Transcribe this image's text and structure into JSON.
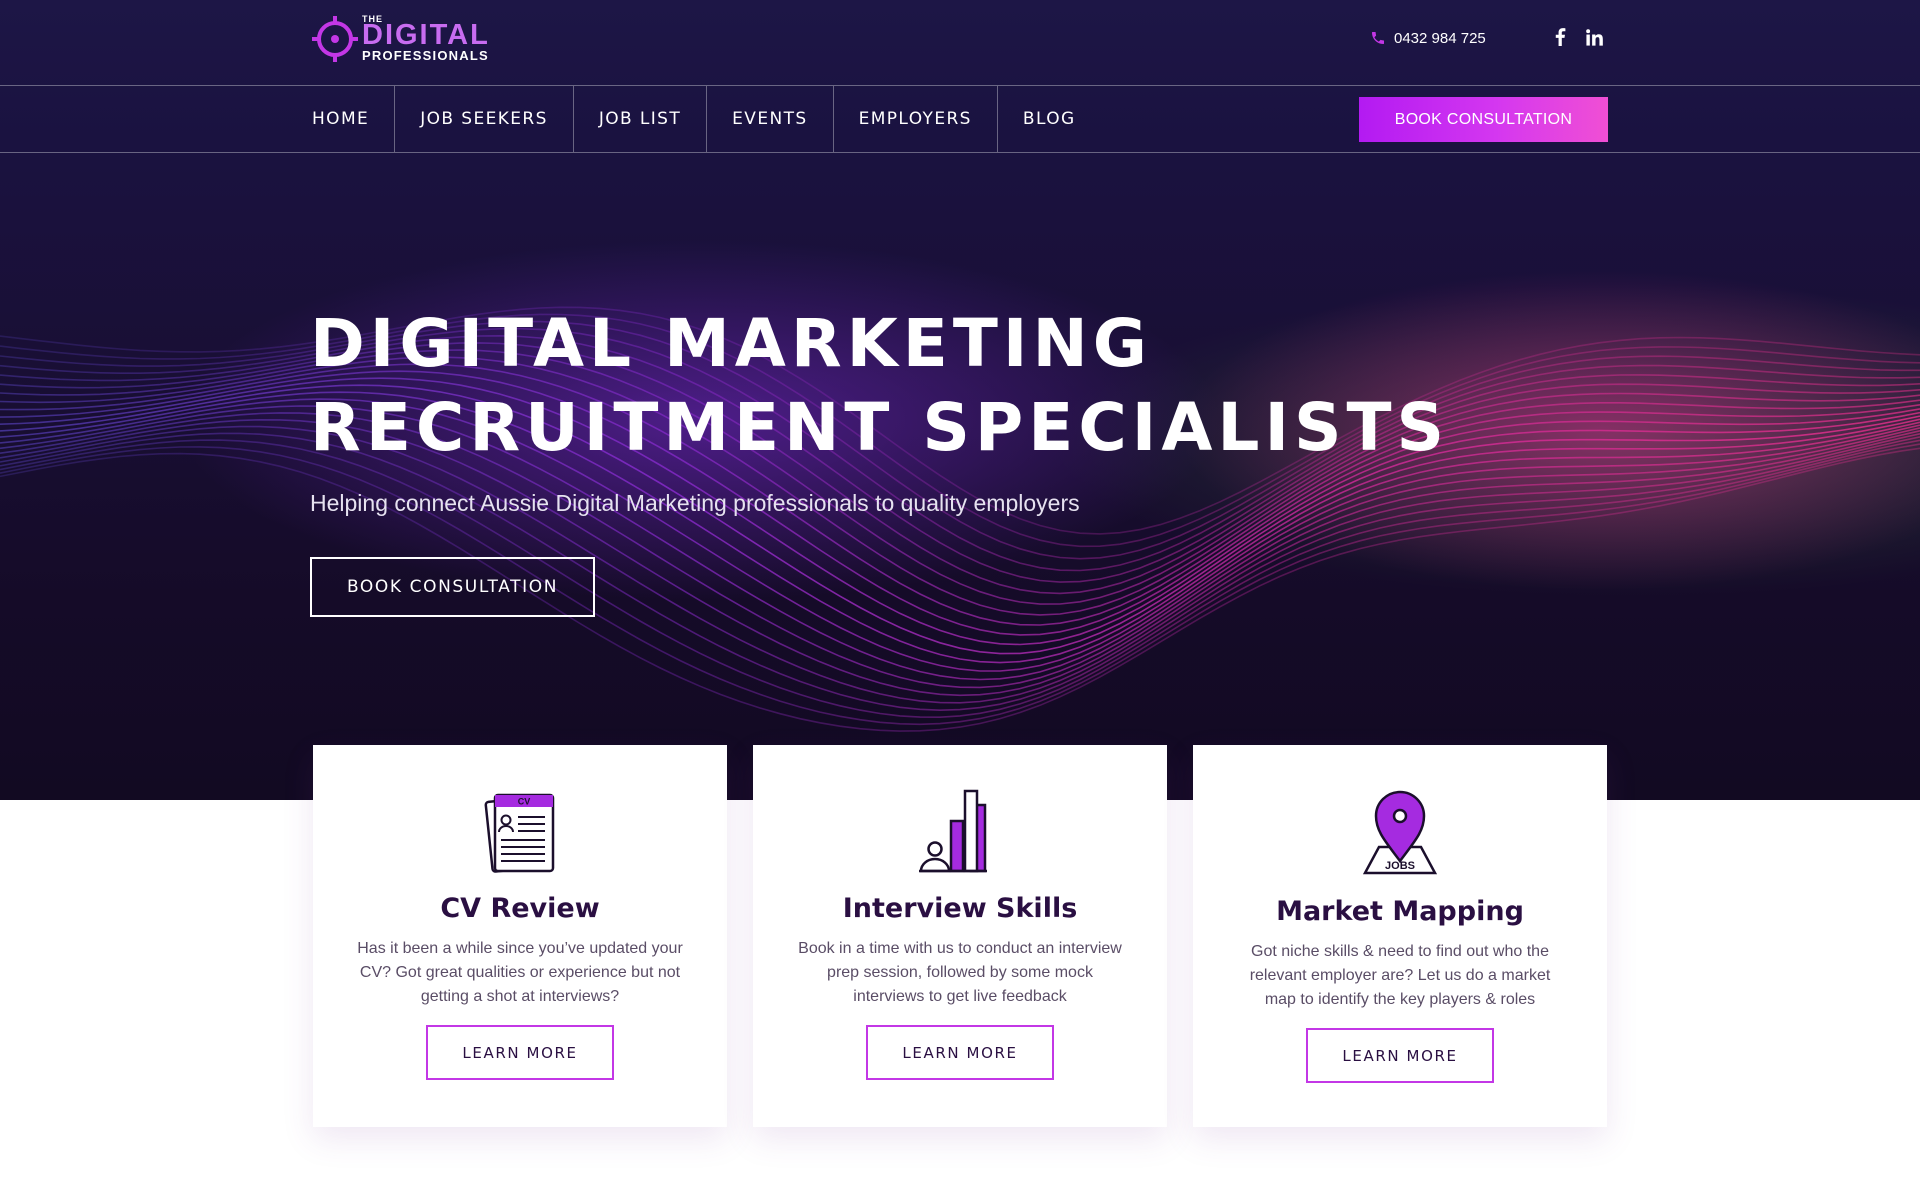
{
  "brand": {
    "logo_the": "THE",
    "logo_main": "DIGITAL",
    "logo_sub": "PROFESSIONALS"
  },
  "contact": {
    "phone": "0432 984 725",
    "social": [
      "facebook-icon",
      "linkedin-icon"
    ]
  },
  "nav": {
    "items": [
      "HOME",
      "JOB SEEKERS",
      "JOB LIST",
      "EVENTS",
      "EMPLOYERS",
      "BLOG"
    ],
    "cta": "BOOK CONSULTATION"
  },
  "hero": {
    "title_line1": "DIGITAL MARKETING",
    "title_line2": "RECRUITMENT SPECIALISTS",
    "subtitle": "Helping connect Aussie Digital Marketing professionals to quality employers",
    "button": "BOOK CONSULTATION"
  },
  "cards": [
    {
      "icon": "cv-document-icon",
      "title": "CV Review",
      "desc": "Has it been a while since you’ve updated your CV? Got great qualities or experience but not getting a shot at interviews?",
      "button": "LEARN MORE",
      "icon_text": "CV"
    },
    {
      "icon": "interview-chart-icon",
      "title": "Interview Skills",
      "desc": "Book in a time with us to conduct an interview prep session, followed by some mock interviews to get live feedback",
      "button": "LEARN MORE"
    },
    {
      "icon": "jobs-map-pin-icon",
      "title": "Market Mapping",
      "desc": "Got niche skills & need to find out who the relevant employer are? Let us do a market map to identify the key players & roles",
      "button": "LEARN MORE",
      "icon_text": "JOBS"
    }
  ],
  "colors": {
    "accent": "#c337e6",
    "cta_gradient_start": "#b31af2",
    "cta_gradient_end": "#f04fd4",
    "hero_bg": "#190f35"
  }
}
